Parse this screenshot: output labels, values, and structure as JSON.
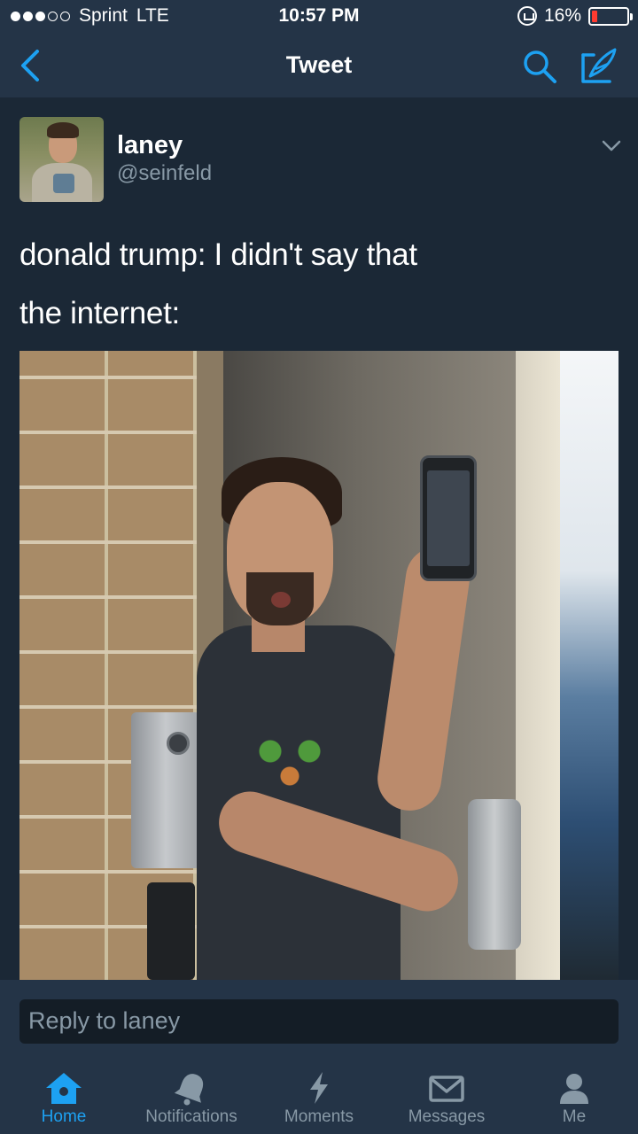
{
  "status_bar": {
    "signal_dots": [
      true,
      true,
      true,
      false,
      false
    ],
    "carrier": "Sprint",
    "network": "LTE",
    "time": "10:57 PM",
    "battery_percent_label": "16%",
    "battery_level": 0.16
  },
  "nav": {
    "title": "Tweet",
    "back_icon": "chevron-left-icon",
    "search_icon": "search-icon",
    "compose_icon": "compose-tweet-icon"
  },
  "tweet": {
    "display_name": "laney",
    "handle": "@seinfeld",
    "lines": [
      "donald trump: I didn't say that",
      "the internet:"
    ]
  },
  "reply": {
    "placeholder": "Reply to laney"
  },
  "tabs": [
    {
      "label": "Home",
      "icon": "home-icon",
      "active": true
    },
    {
      "label": "Notifications",
      "icon": "bell-icon",
      "active": false
    },
    {
      "label": "Moments",
      "icon": "lightning-icon",
      "active": false
    },
    {
      "label": "Messages",
      "icon": "envelope-icon",
      "active": false
    },
    {
      "label": "Me",
      "icon": "person-icon",
      "active": false
    }
  ],
  "colors": {
    "background": "#1b2836",
    "bar": "#243447",
    "accent": "#1da1f2",
    "muted": "#8899a6"
  }
}
